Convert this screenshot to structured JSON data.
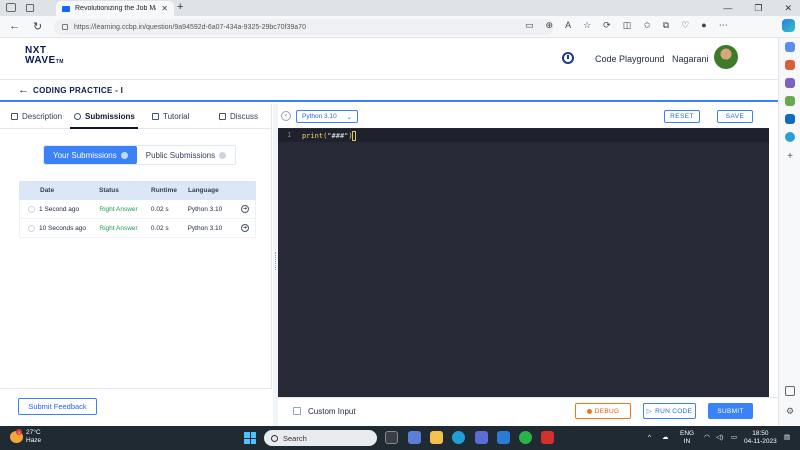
{
  "browser": {
    "tab_title": "Revolutionizing the Job Market |",
    "url": "https://learning.ccbp.in/question/9a94592d-6a07-434a-9325-29bc70f39a70"
  },
  "header": {
    "logo_line1": "NXT",
    "logo_line2": "WAVE",
    "logo_tm": "TM",
    "code_playground": "Code Playground",
    "username": "Nagarani"
  },
  "page": {
    "title": "CODING PRACTICE - I"
  },
  "panel_tabs": [
    {
      "label": "Description"
    },
    {
      "label": "Submissions"
    },
    {
      "label": "Tutorial"
    },
    {
      "label": "Discuss"
    }
  ],
  "submissions": {
    "toggle_yours": "Your Submissions",
    "toggle_public": "Public Submissions",
    "columns": [
      "Date",
      "Status",
      "Runtime",
      "Language"
    ],
    "rows": [
      {
        "date": "1 Second ago",
        "status": "Right Answer",
        "runtime": "0.02 s",
        "language": "Python 3.10"
      },
      {
        "date": "10 Seconds ago",
        "status": "Right Answer",
        "runtime": "0.02 s",
        "language": "Python 3.10"
      }
    ]
  },
  "footer_left": {
    "submit_feedback": "Submit Feedback"
  },
  "editor": {
    "language": "Python 3.10",
    "reset": "RESET",
    "save": "SAVE",
    "line_number": "1",
    "code_fn": "print(",
    "code_str": "\"###\"",
    "code_end": ")",
    "custom_input": "Custom Input",
    "debug": "DEBUG",
    "run_code": "RUN CODE",
    "submit": "SUBMIT"
  },
  "taskbar": {
    "temperature": "27°C",
    "weather": "Haze",
    "search": "Search",
    "lang1": "ENG",
    "lang2": "IN",
    "time": "18:50",
    "date": "04-11-2023"
  },
  "colors": {
    "accent": "#3b82f6",
    "success": "#22a05a",
    "debug": "#f97316",
    "editor_bg": "#272a36"
  }
}
